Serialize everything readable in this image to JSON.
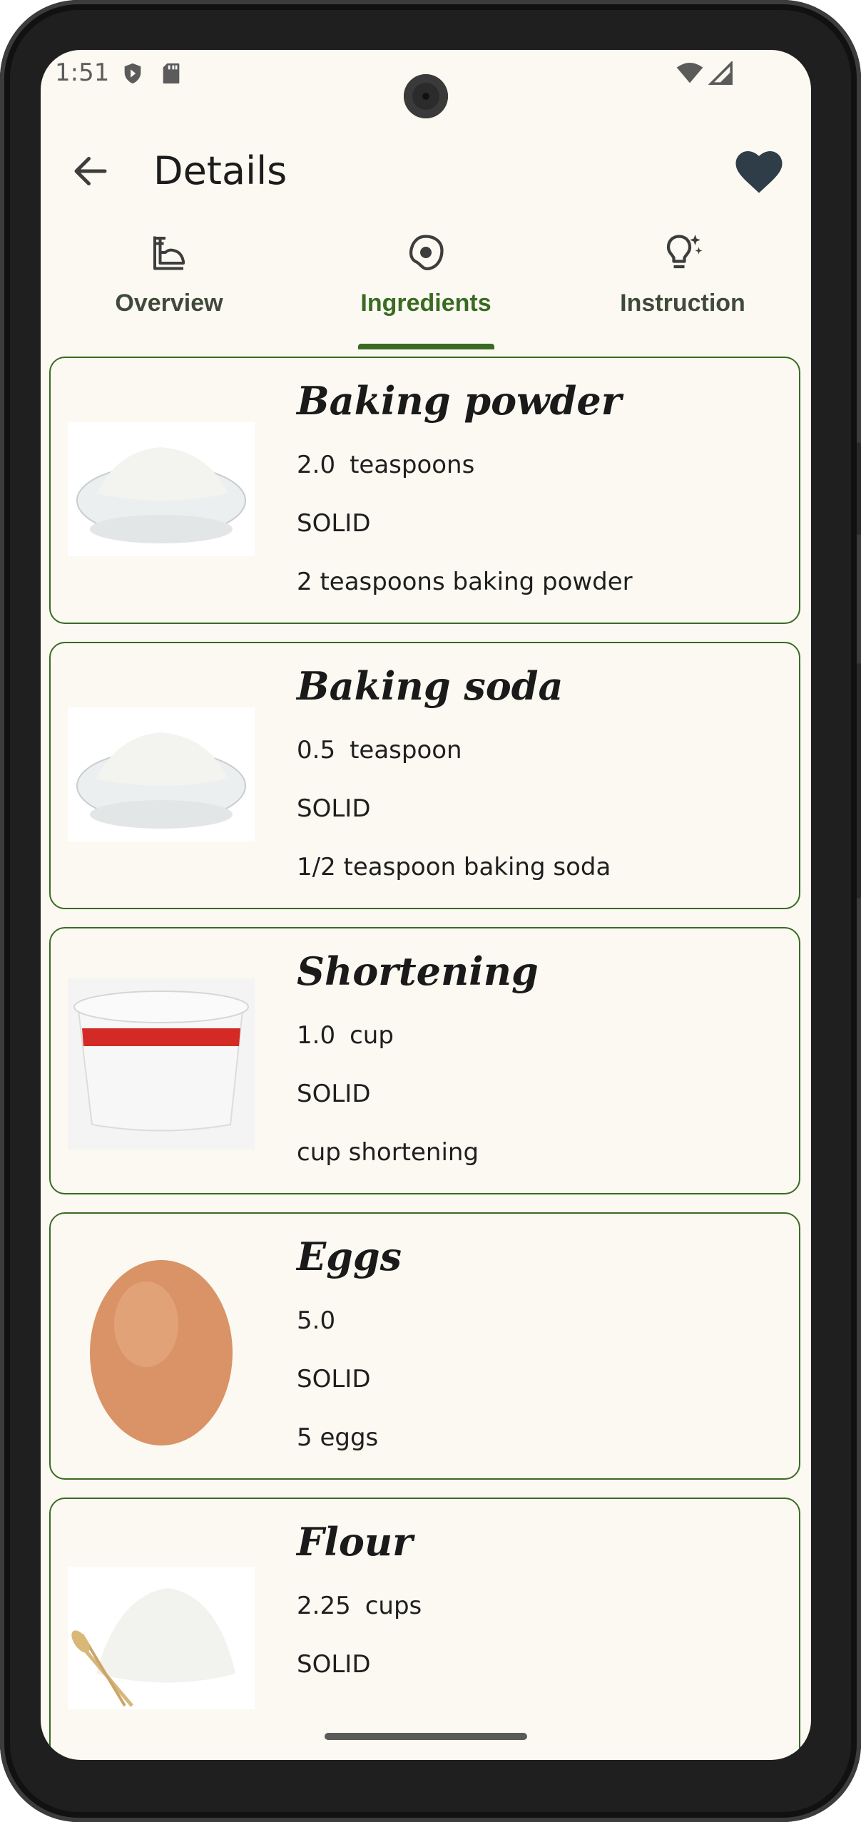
{
  "status_bar": {
    "time": "1:51"
  },
  "top_bar": {
    "title": "Details",
    "back_icon": "arrow-back-icon",
    "favorite_icon": "heart-icon"
  },
  "tabs": [
    {
      "label": "Overview",
      "icon": "chef-icon",
      "active": false
    },
    {
      "label": "Ingredients",
      "icon": "egg-icon",
      "active": true
    },
    {
      "label": "Instruction",
      "icon": "lightbulb-icon",
      "active": false
    }
  ],
  "ingredients": [
    {
      "name": "Baking powder",
      "amount": "2.0",
      "unit": "teaspoons",
      "consistency": "SOLID",
      "original": "2 teaspoons baking powder",
      "image": "powder-bowl"
    },
    {
      "name": "Baking soda",
      "amount": "0.5",
      "unit": "teaspoon",
      "consistency": "SOLID",
      "original": "1/2 teaspoon baking soda",
      "image": "powder-bowl"
    },
    {
      "name": "Shortening",
      "amount": "1.0",
      "unit": "cup",
      "consistency": "SOLID",
      "original": "cup shortening",
      "image": "tub"
    },
    {
      "name": "Eggs",
      "amount": "5.0",
      "unit": "",
      "consistency": "SOLID",
      "original": "5 eggs",
      "image": "egg"
    },
    {
      "name": "Flour",
      "amount": "2.25",
      "unit": "cups",
      "consistency": "SOLID",
      "original": "",
      "image": "flour"
    }
  ],
  "colors": {
    "accent": "#3a6b23",
    "background": "#fbf9f1",
    "heart": "#2e3d47"
  }
}
